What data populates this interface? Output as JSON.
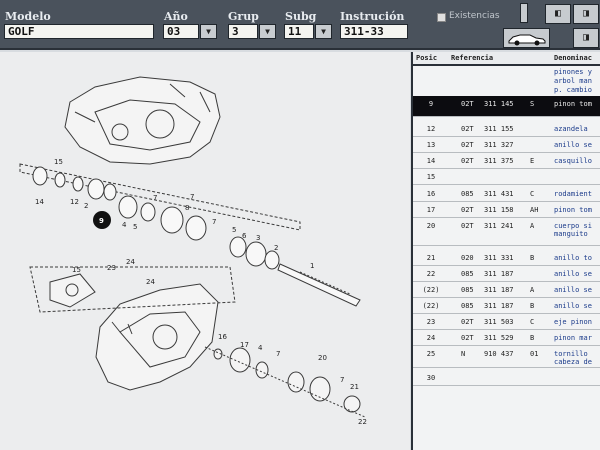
{
  "toolbar": {
    "modelo_label": "Modelo",
    "modelo_value": "GOLF",
    "ano_label": "Año",
    "ano_value": "03",
    "grup_label": "Grup",
    "grup_value": "3",
    "subg_label": "Subg",
    "subg_value": "11",
    "instruccion_label": "Instrución",
    "instruccion_value": "311-33",
    "existencias_label": "Existencias"
  },
  "diagram": {
    "callouts": [
      "1",
      "2",
      "3",
      "4",
      "5",
      "6",
      "7",
      "7",
      "8",
      "9",
      "12",
      "13",
      "14",
      "15",
      "16",
      "17",
      "20",
      "21",
      "22",
      "23",
      "24",
      "4",
      "5",
      "7",
      "2",
      "3",
      "4",
      "7"
    ]
  },
  "parts": {
    "headers": [
      "Posic",
      "Referencia",
      "Denominac"
    ],
    "pre_desc": [
      "pinones y",
      "arbol man",
      "p. cambio"
    ],
    "rows": [
      {
        "pos": "9",
        "pre": "02T",
        "num": "311 145",
        "suf": "S",
        "desc": "pinon tom",
        "selected": true
      },
      {
        "pos": "12",
        "pre": "02T",
        "num": "311 155",
        "suf": "",
        "desc": "azandela"
      },
      {
        "pos": "13",
        "pre": "02T",
        "num": "311 327",
        "suf": "",
        "desc": "anillo se"
      },
      {
        "pos": "14",
        "pre": "02T",
        "num": "311 375",
        "suf": "E",
        "desc": "casquillo"
      },
      {
        "pos": "15",
        "pre": "",
        "num": "",
        "suf": "",
        "desc": ""
      },
      {
        "pos": "16",
        "pre": "085",
        "num": "311 431",
        "suf": "C",
        "desc": "rodamient"
      },
      {
        "pos": "17",
        "pre": "02T",
        "num": "311 158",
        "suf": "AH",
        "desc": "pinon tom"
      },
      {
        "pos": "20",
        "pre": "02T",
        "num": "311 241",
        "suf": "A",
        "desc": "cuerpo si manguito"
      },
      {
        "pos": "21",
        "pre": "020",
        "num": "311 331",
        "suf": "B",
        "desc": "anillo to"
      },
      {
        "pos": "22",
        "pre": "085",
        "num": "311 187",
        "suf": "",
        "desc": "anillo se"
      },
      {
        "pos": "(22)",
        "pre": "085",
        "num": "311 187",
        "suf": "A",
        "desc": "anillo se"
      },
      {
        "pos": "(22)",
        "pre": "085",
        "num": "311 187",
        "suf": "B",
        "desc": "anillo se"
      },
      {
        "pos": "23",
        "pre": "02T",
        "num": "311 503",
        "suf": "C",
        "desc": "eje pinon"
      },
      {
        "pos": "24",
        "pre": "02T",
        "num": "311 529",
        "suf": "B",
        "desc": "pinon mar"
      },
      {
        "pos": "25",
        "pre": "N",
        "num": "910 437",
        "suf": "01",
        "desc": "tornillo cabeza de"
      },
      {
        "pos": "30",
        "pre": "",
        "num": "",
        "suf": "",
        "desc": ""
      }
    ]
  }
}
